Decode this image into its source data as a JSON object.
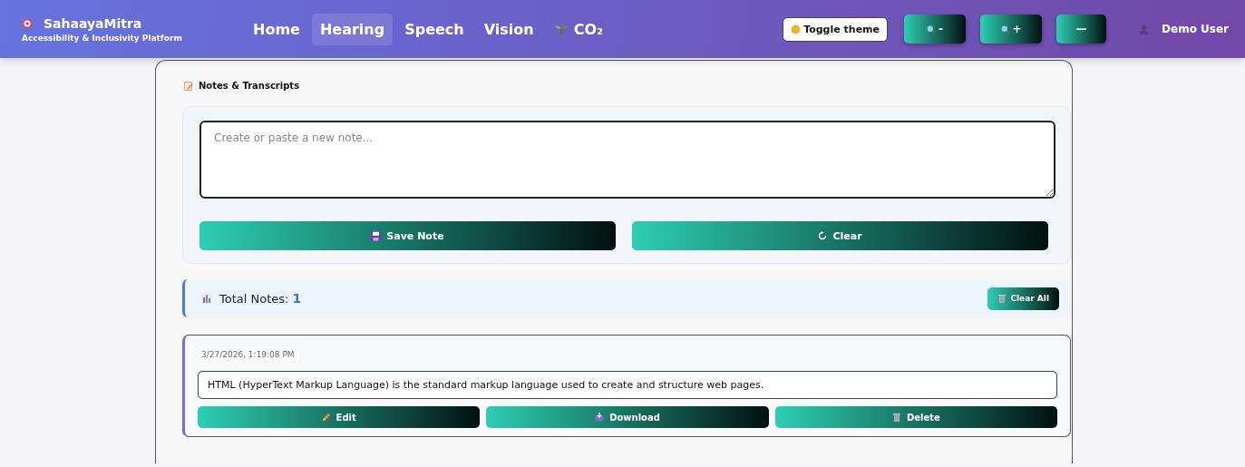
{
  "brand": {
    "name": "SahaayaMitra",
    "tagline": "Accessibility & Inclusivity Platform"
  },
  "nav": [
    {
      "label": "Home",
      "selected": false
    },
    {
      "label": "Hearing",
      "selected": true
    },
    {
      "label": "Speech",
      "selected": false
    },
    {
      "label": "Vision",
      "selected": false
    },
    {
      "label": "CO₂",
      "selected": false,
      "kind": "eco"
    }
  ],
  "toolbar": {
    "theme_button": "Toggle theme",
    "zoom_out": "-",
    "zoom_in": "+",
    "reset": "—",
    "user": "Demo User"
  },
  "panel": {
    "title": "Notes & Transcripts",
    "editor": {
      "placeholder": "Create or paste a new note..."
    },
    "buttons": [
      {
        "label": "Save Note",
        "kind": "save"
      },
      {
        "label": "Clear",
        "kind": "clear"
      }
    ]
  },
  "summary": {
    "label": "Total Notes:",
    "count": "1",
    "button": "Clear All"
  },
  "notes": [
    {
      "timestamp": "3/27/2026, 1:19:08 PM",
      "text": "HTML (HyperText Markup Language) is the standard markup language used to create and structure web pages.",
      "actions": [
        {
          "label": "Edit",
          "kind": "edit"
        },
        {
          "label": "Download",
          "kind": "download"
        },
        {
          "label": "Delete",
          "kind": "delete"
        }
      ]
    }
  ]
}
